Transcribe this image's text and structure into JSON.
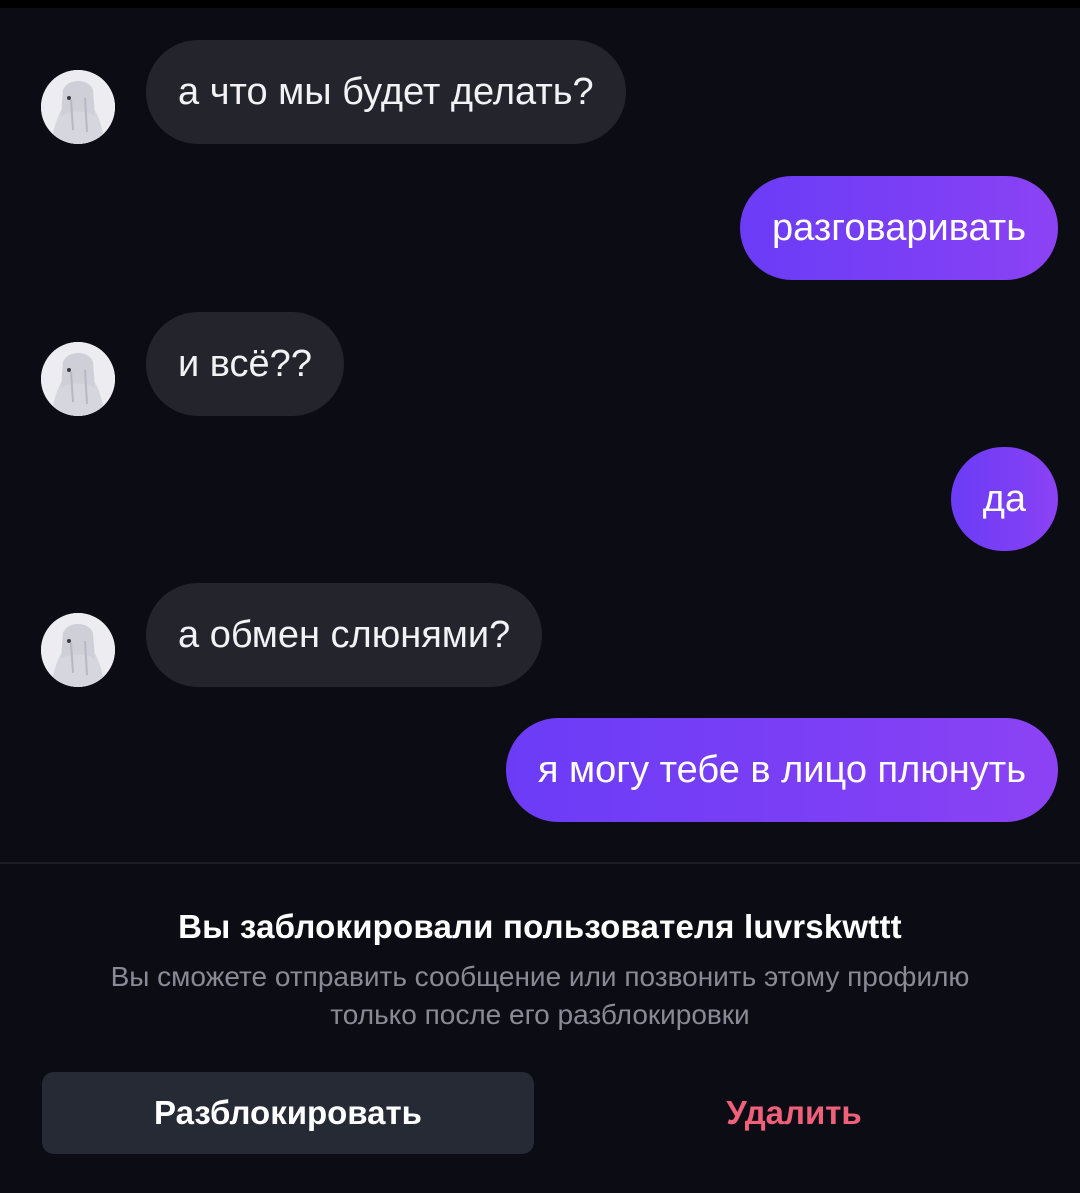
{
  "conversation": {
    "messages": [
      {
        "side": "incoming",
        "text": "а что мы будет делать?"
      },
      {
        "side": "outgoing",
        "text": "разговаривать"
      },
      {
        "side": "incoming",
        "text": "и всё??"
      },
      {
        "side": "outgoing",
        "text": "да"
      },
      {
        "side": "incoming",
        "text": "а обмен слюнями?"
      },
      {
        "side": "outgoing",
        "text": "я могу тебе в лицо плюнуть"
      }
    ],
    "avatar_icon": "profile-photo-avatar"
  },
  "blocked_notice": {
    "title": "Вы заблокировали пользователя luvrskwttt",
    "description": "Вы сможете отправить сообщение или позвонить этому профилю только после его разблокировки"
  },
  "actions": {
    "unblock_label": "Разблокировать",
    "delete_label": "Удалить"
  },
  "colors": {
    "background": "#0c0c14",
    "incoming_bubble": "#24242d",
    "outgoing_bubble": "#7b3ff5",
    "delete_text": "#f0607a",
    "secondary_text": "#8a8a96"
  }
}
